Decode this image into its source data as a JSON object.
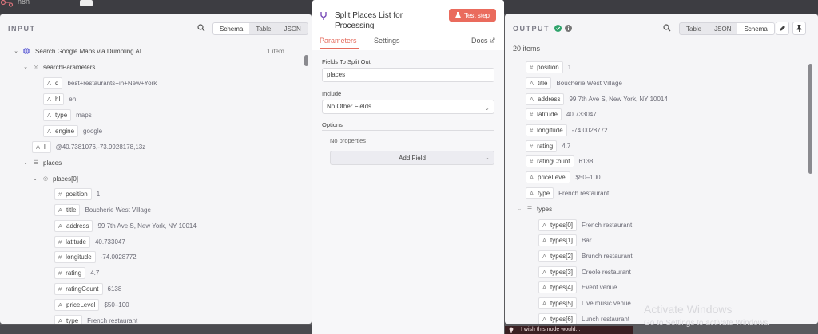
{
  "app": {
    "title": "n8n"
  },
  "input": {
    "title": "INPUT",
    "tabs": [
      "Schema",
      "Table",
      "JSON"
    ],
    "node_name": "Search Google Maps via Dumpling AI",
    "item_count": "1 item",
    "rows": [
      {
        "label": "searchParameters",
        "type": "object"
      },
      {
        "label": "q",
        "type": "string",
        "value": "best+restaurants+in+New+York"
      },
      {
        "label": "hl",
        "type": "string",
        "value": "en"
      },
      {
        "label": "type",
        "type": "string",
        "value": "maps"
      },
      {
        "label": "engine",
        "type": "string",
        "value": "google"
      },
      {
        "label": "ll",
        "type": "string",
        "value": "@40.7381076,-73.9928178,13z"
      },
      {
        "label": "places",
        "type": "array"
      },
      {
        "label": "places[0]",
        "type": "object"
      },
      {
        "label": "position",
        "type": "number",
        "value": "1"
      },
      {
        "label": "title",
        "type": "string",
        "value": "Boucherie West Village"
      },
      {
        "label": "address",
        "type": "string",
        "value": "99 7th Ave S, New York, NY 10014"
      },
      {
        "label": "latitude",
        "type": "number",
        "value": "40.733047"
      },
      {
        "label": "longitude",
        "type": "number",
        "value": "-74.0028772"
      },
      {
        "label": "rating",
        "type": "number",
        "value": "4.7"
      },
      {
        "label": "ratingCount",
        "type": "number",
        "value": "6138"
      },
      {
        "label": "priceLevel",
        "type": "string",
        "value": "$50–100"
      },
      {
        "label": "type",
        "type": "string",
        "value": "French restaurant"
      }
    ]
  },
  "node": {
    "title": "Split Places List for Processing",
    "test_step": "Test step",
    "tabs": {
      "parameters": "Parameters",
      "settings": "Settings",
      "docs": "Docs"
    },
    "fields_label": "Fields To Split Out",
    "fields_value": "places",
    "include_label": "Include",
    "include_value": "No Other Fields",
    "options_label": "Options",
    "no_properties": "No properties",
    "add_field": "Add Field"
  },
  "output": {
    "title": "OUTPUT",
    "status": "success",
    "tabs": [
      "Table",
      "JSON",
      "Schema"
    ],
    "item_count": "20 items",
    "rows": [
      {
        "label": "position",
        "type": "number",
        "value": "1"
      },
      {
        "label": "title",
        "type": "string",
        "value": "Boucherie West Village"
      },
      {
        "label": "address",
        "type": "string",
        "value": "99 7th Ave S, New York, NY 10014"
      },
      {
        "label": "latitude",
        "type": "number",
        "value": "40.733047"
      },
      {
        "label": "longitude",
        "type": "number",
        "value": "-74.0028772"
      },
      {
        "label": "rating",
        "type": "number",
        "value": "4.7"
      },
      {
        "label": "ratingCount",
        "type": "number",
        "value": "6138"
      },
      {
        "label": "priceLevel",
        "type": "string",
        "value": "$50–100"
      },
      {
        "label": "type",
        "type": "string",
        "value": "French restaurant"
      },
      {
        "label": "types",
        "type": "array"
      },
      {
        "label": "types[0]",
        "type": "string",
        "value": "French restaurant"
      },
      {
        "label": "types[1]",
        "type": "string",
        "value": "Bar"
      },
      {
        "label": "types[2]",
        "type": "string",
        "value": "Brunch restaurant"
      },
      {
        "label": "types[3]",
        "type": "string",
        "value": "Creole restaurant"
      },
      {
        "label": "types[4]",
        "type": "string",
        "value": "Event venue"
      },
      {
        "label": "types[5]",
        "type": "string",
        "value": "Live music venue"
      },
      {
        "label": "types[6]",
        "type": "string",
        "value": "Lunch restaurant"
      }
    ]
  },
  "feedback": {
    "text": "I wish this node would..."
  },
  "watermark": {
    "line1": "Activate Windows",
    "line2": "Go to Settings to activate Windows."
  },
  "colors": {
    "accent": "#e56d5f",
    "success": "#2fa36b"
  }
}
